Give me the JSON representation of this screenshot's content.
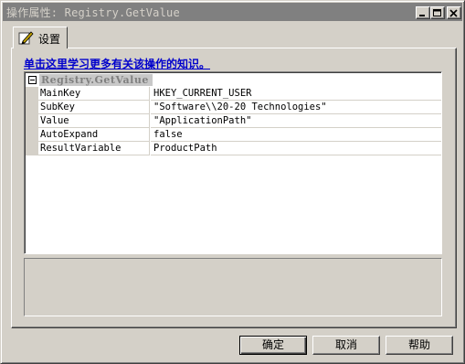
{
  "window": {
    "title": "操作属性: Registry.GetValue"
  },
  "tab": {
    "label": "设置",
    "icon": "edit-pencil-icon"
  },
  "help_link": "单击这里学习更多有关该操作的知识。",
  "grid": {
    "category": "Registry.GetValue",
    "rows": [
      {
        "name": "MainKey",
        "value": "HKEY_CURRENT_USER"
      },
      {
        "name": "SubKey",
        "value": "\"Software\\\\20-20 Technologies\""
      },
      {
        "name": "Value",
        "value": "\"ApplicationPath\""
      },
      {
        "name": "AutoExpand",
        "value": "false"
      },
      {
        "name": "ResultVariable",
        "value": "ProductPath"
      }
    ]
  },
  "buttons": {
    "ok": "确定",
    "cancel": "取消",
    "help": "帮助"
  },
  "colors": {
    "face": "#d4d0c8",
    "titlebar_inactive": "#808080",
    "link": "#0000cc"
  }
}
